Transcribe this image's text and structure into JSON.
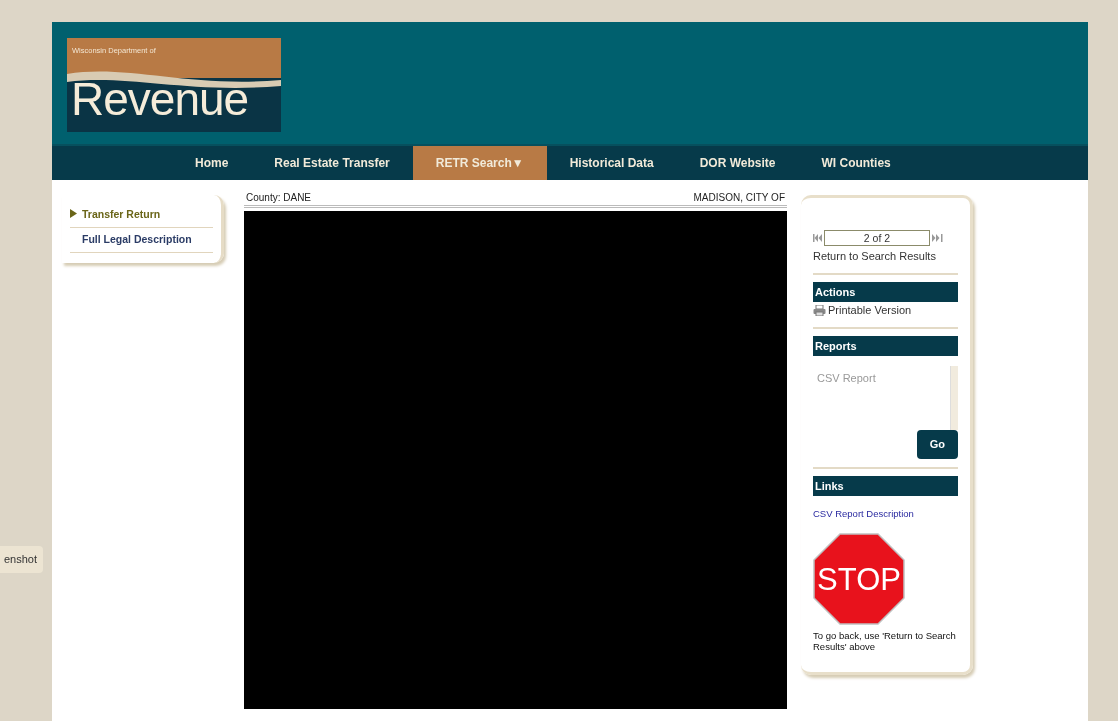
{
  "logo": {
    "line1": "Wisconsin Department of",
    "line2": "Revenue"
  },
  "nav": [
    {
      "label": "Home",
      "selected": false
    },
    {
      "label": "Real Estate Transfer",
      "selected": false
    },
    {
      "label": "RETR Search▼",
      "selected": true
    },
    {
      "label": "Historical Data",
      "selected": false
    },
    {
      "label": "DOR Website",
      "selected": false
    },
    {
      "label": "WI Counties",
      "selected": false
    }
  ],
  "side_menu": [
    {
      "label": "Transfer Return",
      "selected": true
    },
    {
      "label": "Full Legal Description",
      "selected": false
    }
  ],
  "record": {
    "county": "County: DANE",
    "municipality": "MADISON, CITY OF"
  },
  "pager": {
    "value": "2 of 2",
    "return_link": "Return to Search Results"
  },
  "actions": {
    "title": "Actions",
    "items": [
      "Printable Version"
    ]
  },
  "reports": {
    "title": "Reports",
    "options": [
      {
        "label": "CSV Report",
        "disabled": true
      }
    ],
    "button": "Go"
  },
  "links": {
    "title": "Links",
    "items": [
      "CSV Report Description"
    ]
  },
  "stop": {
    "sign": "STOP",
    "note": "To go back, use 'Return to Search Results' above"
  },
  "side_tab": {
    "label": "enshot"
  }
}
